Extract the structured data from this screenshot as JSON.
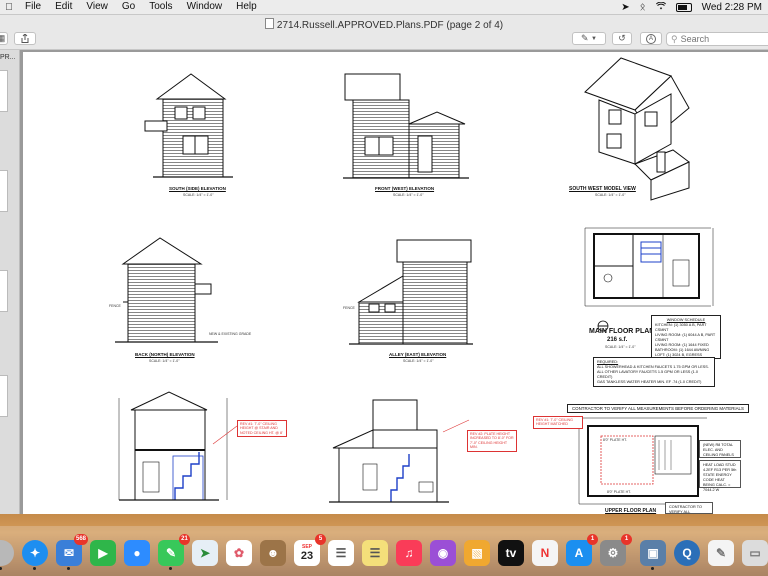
{
  "menubar": {
    "apple": "",
    "items": [
      "File",
      "Edit",
      "View",
      "Go",
      "Tools",
      "Window",
      "Help"
    ],
    "clock": "Wed 2:28 PM",
    "status_icons": [
      "location-icon",
      "bluetooth-icon",
      "wifi-icon",
      "battery-icon"
    ]
  },
  "window": {
    "title": "2714.Russell.APPROVED.Plans.PDF (page 2 of 4)",
    "search_placeholder": "Search",
    "sidebar_label": "PR..."
  },
  "drawings": {
    "south_elevation": {
      "label": "SOUTH (SIDE) ELEVATION",
      "scale": "SCALE: 1/4\" = 1'-0\""
    },
    "front_elevation": {
      "label": "FRONT (WEST) ELEVATION",
      "scale": "SCALE: 1/4\" = 1'-0\""
    },
    "model_view": {
      "label": "SOUTH WEST MODEL VIEW",
      "scale": "SCALE: 1/4\" = 1'-0\""
    },
    "back_elevation": {
      "label": "BACK (NORTH) ELEVATION",
      "scale": "SCALE: 1/4\" = 1'-0\"",
      "fence": "FENCE",
      "grade": "NEW & EXISTING GRADE"
    },
    "alley_elevation": {
      "label": "ALLEY (EAST) ELEVATION",
      "scale": "SCALE: 1/4\" = 1'-0\"",
      "fence": "FENCE"
    },
    "main_floor": {
      "title": "MAIN FLOOR PLAN",
      "area": "216 s.f.",
      "scale": "SCALE: 1/4\" = 1'-0\"",
      "window_schedule": "WINDOW SCHEDULE",
      "schedule_rows": [
        "KITCHEN: (1) 3050 A B, PART CSMNT",
        "LIVING ROOM: (1) 6044 A B, PART CSMNT",
        "LIVING ROOM: (1) 1644 FIXED",
        "BATHROOM: (1) 1644 AWNING",
        "LOFT: (1) 3024 B, EGRESS WINDOW"
      ],
      "required_title": "REQUIRED:",
      "required_lines": [
        "ALL SHOWERHEAD & KITCHEN FAUCETS 1.75 GPM OR LESS.",
        "ALL OTHER LAVATORY FAUCETS 1.5 GPM OR LESS (1.0 CREDIT)",
        "GAS TANKLESS WATER HEATER MIN. EF .74 (1.0 CREDIT)"
      ]
    },
    "section_a": {
      "note": "REV #1: 7'-0\" CEILING HEIGHT @ STAIR AND NOTED CEILING HT. @ 8'"
    },
    "section_b": {
      "note": "REV #2: PLATE HEIGHT INCREASED TO 8'-0\" FOR 7'-0\" CEILING HEIGHT MIN."
    },
    "upper_floor": {
      "contractor_note": "CONTRACTOR TO VERIFY ALL MEASUREMENTS BEFORE ORDERING MATERIALS",
      "rev_note": "REV #1: 7'-0\" CEILING HEIGHT MATCHED",
      "side_note": "(NEW) R8 TOTAL ELEC. AND CEILING PANELS",
      "side_note2": "HEAT LOAD STUD 4.2EF R13 PER 5th STATE ENERGY CODE HEAT BEING CALC. = 7044.2 W",
      "contractor_verify": "CONTRACTOR TO VERIFY ALL MEASUREMENTS BEFORE",
      "plate_ht_1": "8'0\" PLATE HT.",
      "plate_ht_2": "8'0\" PLATE HT.",
      "title": "UPPER FLOOR PLAN"
    }
  },
  "dock": {
    "badges": {
      "mail": "568",
      "messages": "21",
      "calendar_day": "23",
      "calendar_badge": "5",
      "appstore": "1",
      "settings": "1"
    },
    "calendar_month": "SEP"
  }
}
